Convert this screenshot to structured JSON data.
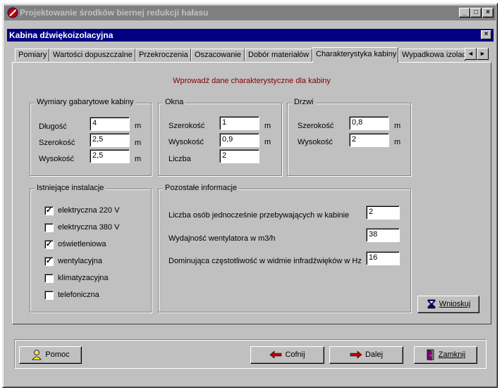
{
  "window": {
    "title": "Projektowanie środków biernej redukcji hałasu",
    "min": "_",
    "max": "□",
    "close": "×"
  },
  "dialog": {
    "title": "Kabina dźwiękoizolacyjna",
    "close": "×"
  },
  "tabs": [
    "Pomiary",
    "Wartości dopuszczalne",
    "Przekroczenia",
    "Oszacowanie",
    "Dobór materiałów",
    "Charakterystyka kabiny",
    "Wypadkowa izolac"
  ],
  "active_tab": "Charakterystyka kabiny",
  "message": "Wprowadź dane charakterystyczne dla kabiny",
  "wymiary": {
    "title": "Wymiary gabarytowe kabiny",
    "rows": [
      {
        "label": "Długość",
        "value": "4",
        "unit": "m"
      },
      {
        "label": "Szerokość",
        "value": "2,5",
        "unit": "m"
      },
      {
        "label": "Wysokość",
        "value": "2,5",
        "unit": "m"
      }
    ]
  },
  "okna": {
    "title": "Okna",
    "rows": [
      {
        "label": "Szerokość",
        "value": "1",
        "unit": "m"
      },
      {
        "label": "Wysokość",
        "value": "0,9",
        "unit": "m"
      },
      {
        "label": "Liczba",
        "value": "2",
        "unit": ""
      }
    ]
  },
  "drzwi": {
    "title": "Drzwi",
    "rows": [
      {
        "label": "Szerokość",
        "value": "0,8",
        "unit": "m"
      },
      {
        "label": "Wysokość",
        "value": "2",
        "unit": "m"
      }
    ]
  },
  "instalacje": {
    "title": "Istniejące instalacje",
    "items": [
      {
        "label": "elektryczna 220 V",
        "checked": true,
        "mark": "✓"
      },
      {
        "label": "elektryczna 380 V",
        "checked": false,
        "mark": ""
      },
      {
        "label": "oświetleniowa",
        "checked": true,
        "mark": "✓"
      },
      {
        "label": "wentylacyjna",
        "checked": true,
        "mark": "✓"
      },
      {
        "label": "klimatyzacyjna",
        "checked": false,
        "mark": ""
      },
      {
        "label": "telefoniczna",
        "checked": false,
        "mark": ""
      }
    ]
  },
  "pozostale": {
    "title": "Pozostałe informacje",
    "rows": [
      {
        "label": "Liczba osób jednocześnie przebywających w kabinie",
        "value": "2"
      },
      {
        "label": "Wydajność wentylatora w m3/h",
        "value": "38"
      },
      {
        "label": "Dominująca częstotliwość w widmie infradźwięków w Hz",
        "value": "16"
      }
    ]
  },
  "buttons": {
    "wnioskuj": "Wnioskuj",
    "pomoc": "Pomoc",
    "cofnij": "Cofnij",
    "dalej": "Dalej",
    "zamknij": "Zamknij"
  },
  "scroll": {
    "left": "◄",
    "right": "►"
  },
  "colors": {
    "title_inactive": "#808080",
    "dialog_title": "#000080",
    "message": "#800000",
    "face": "#c0c0c0"
  }
}
